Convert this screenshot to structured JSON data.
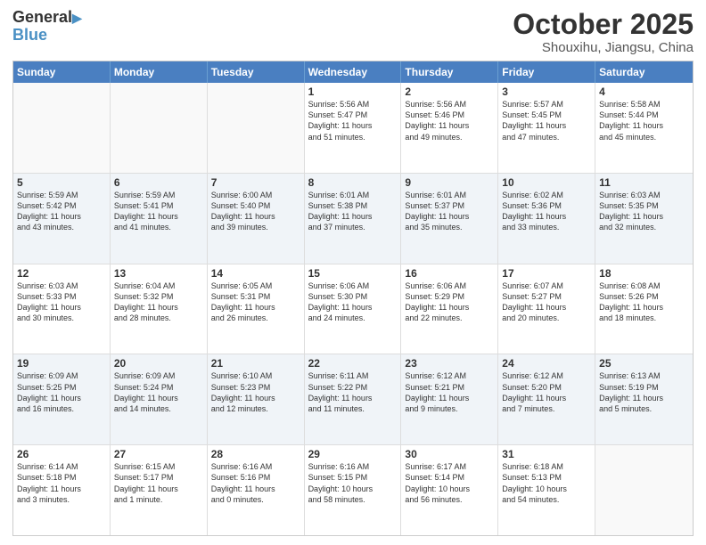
{
  "header": {
    "logo_line1": "General",
    "logo_line2": "Blue",
    "month": "October 2025",
    "location": "Shouxihu, Jiangsu, China"
  },
  "days_of_week": [
    "Sunday",
    "Monday",
    "Tuesday",
    "Wednesday",
    "Thursday",
    "Friday",
    "Saturday"
  ],
  "weeks": [
    [
      {
        "day": "",
        "text": ""
      },
      {
        "day": "",
        "text": ""
      },
      {
        "day": "",
        "text": ""
      },
      {
        "day": "1",
        "text": "Sunrise: 5:56 AM\nSunset: 5:47 PM\nDaylight: 11 hours\nand 51 minutes."
      },
      {
        "day": "2",
        "text": "Sunrise: 5:56 AM\nSunset: 5:46 PM\nDaylight: 11 hours\nand 49 minutes."
      },
      {
        "day": "3",
        "text": "Sunrise: 5:57 AM\nSunset: 5:45 PM\nDaylight: 11 hours\nand 47 minutes."
      },
      {
        "day": "4",
        "text": "Sunrise: 5:58 AM\nSunset: 5:44 PM\nDaylight: 11 hours\nand 45 minutes."
      }
    ],
    [
      {
        "day": "5",
        "text": "Sunrise: 5:59 AM\nSunset: 5:42 PM\nDaylight: 11 hours\nand 43 minutes."
      },
      {
        "day": "6",
        "text": "Sunrise: 5:59 AM\nSunset: 5:41 PM\nDaylight: 11 hours\nand 41 minutes."
      },
      {
        "day": "7",
        "text": "Sunrise: 6:00 AM\nSunset: 5:40 PM\nDaylight: 11 hours\nand 39 minutes."
      },
      {
        "day": "8",
        "text": "Sunrise: 6:01 AM\nSunset: 5:38 PM\nDaylight: 11 hours\nand 37 minutes."
      },
      {
        "day": "9",
        "text": "Sunrise: 6:01 AM\nSunset: 5:37 PM\nDaylight: 11 hours\nand 35 minutes."
      },
      {
        "day": "10",
        "text": "Sunrise: 6:02 AM\nSunset: 5:36 PM\nDaylight: 11 hours\nand 33 minutes."
      },
      {
        "day": "11",
        "text": "Sunrise: 6:03 AM\nSunset: 5:35 PM\nDaylight: 11 hours\nand 32 minutes."
      }
    ],
    [
      {
        "day": "12",
        "text": "Sunrise: 6:03 AM\nSunset: 5:33 PM\nDaylight: 11 hours\nand 30 minutes."
      },
      {
        "day": "13",
        "text": "Sunrise: 6:04 AM\nSunset: 5:32 PM\nDaylight: 11 hours\nand 28 minutes."
      },
      {
        "day": "14",
        "text": "Sunrise: 6:05 AM\nSunset: 5:31 PM\nDaylight: 11 hours\nand 26 minutes."
      },
      {
        "day": "15",
        "text": "Sunrise: 6:06 AM\nSunset: 5:30 PM\nDaylight: 11 hours\nand 24 minutes."
      },
      {
        "day": "16",
        "text": "Sunrise: 6:06 AM\nSunset: 5:29 PM\nDaylight: 11 hours\nand 22 minutes."
      },
      {
        "day": "17",
        "text": "Sunrise: 6:07 AM\nSunset: 5:27 PM\nDaylight: 11 hours\nand 20 minutes."
      },
      {
        "day": "18",
        "text": "Sunrise: 6:08 AM\nSunset: 5:26 PM\nDaylight: 11 hours\nand 18 minutes."
      }
    ],
    [
      {
        "day": "19",
        "text": "Sunrise: 6:09 AM\nSunset: 5:25 PM\nDaylight: 11 hours\nand 16 minutes."
      },
      {
        "day": "20",
        "text": "Sunrise: 6:09 AM\nSunset: 5:24 PM\nDaylight: 11 hours\nand 14 minutes."
      },
      {
        "day": "21",
        "text": "Sunrise: 6:10 AM\nSunset: 5:23 PM\nDaylight: 11 hours\nand 12 minutes."
      },
      {
        "day": "22",
        "text": "Sunrise: 6:11 AM\nSunset: 5:22 PM\nDaylight: 11 hours\nand 11 minutes."
      },
      {
        "day": "23",
        "text": "Sunrise: 6:12 AM\nSunset: 5:21 PM\nDaylight: 11 hours\nand 9 minutes."
      },
      {
        "day": "24",
        "text": "Sunrise: 6:12 AM\nSunset: 5:20 PM\nDaylight: 11 hours\nand 7 minutes."
      },
      {
        "day": "25",
        "text": "Sunrise: 6:13 AM\nSunset: 5:19 PM\nDaylight: 11 hours\nand 5 minutes."
      }
    ],
    [
      {
        "day": "26",
        "text": "Sunrise: 6:14 AM\nSunset: 5:18 PM\nDaylight: 11 hours\nand 3 minutes."
      },
      {
        "day": "27",
        "text": "Sunrise: 6:15 AM\nSunset: 5:17 PM\nDaylight: 11 hours\nand 1 minute."
      },
      {
        "day": "28",
        "text": "Sunrise: 6:16 AM\nSunset: 5:16 PM\nDaylight: 11 hours\nand 0 minutes."
      },
      {
        "day": "29",
        "text": "Sunrise: 6:16 AM\nSunset: 5:15 PM\nDaylight: 10 hours\nand 58 minutes."
      },
      {
        "day": "30",
        "text": "Sunrise: 6:17 AM\nSunset: 5:14 PM\nDaylight: 10 hours\nand 56 minutes."
      },
      {
        "day": "31",
        "text": "Sunrise: 6:18 AM\nSunset: 5:13 PM\nDaylight: 10 hours\nand 54 minutes."
      },
      {
        "day": "",
        "text": ""
      }
    ]
  ]
}
